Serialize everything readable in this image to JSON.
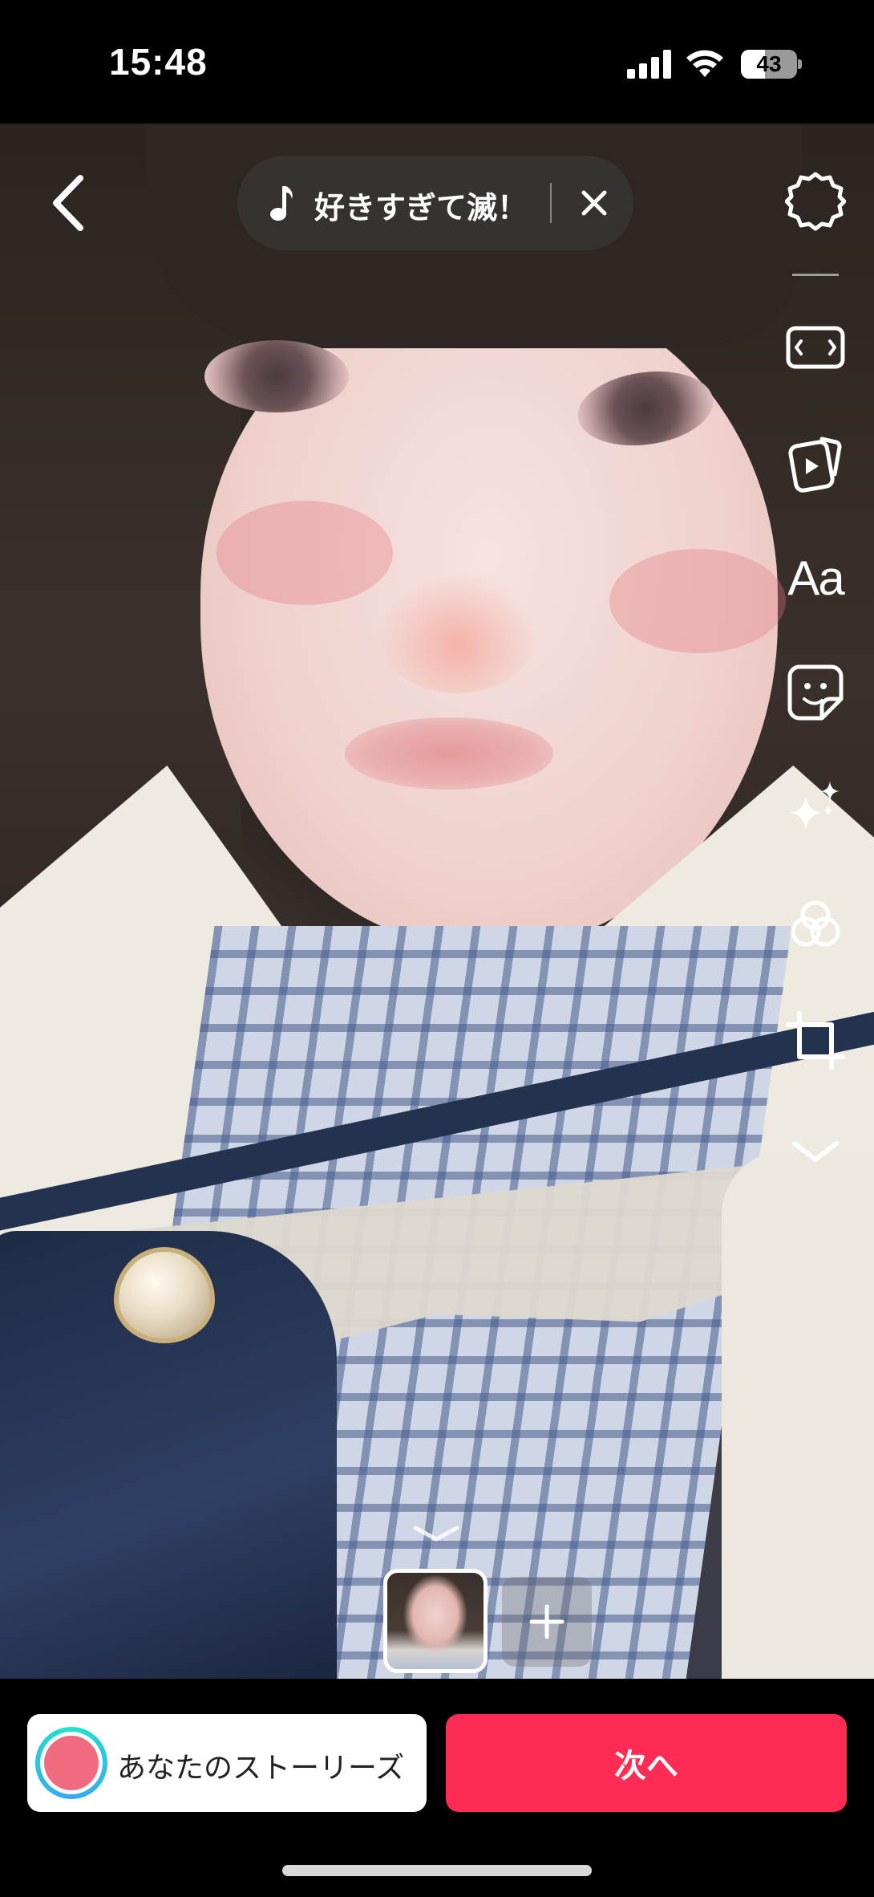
{
  "status_bar": {
    "time": "15:48",
    "battery_level": "43",
    "battery_fraction": 0.43
  },
  "music": {
    "title": "好きすぎて滅！"
  },
  "toolbar": {
    "text_tool_label": "Aa",
    "items": [
      "settings-icon",
      "aspect-ratio-icon",
      "templates-icon",
      "text-icon",
      "sticker-icon",
      "effects-icon",
      "filters-icon",
      "crop-icon",
      "expand-more-icon"
    ]
  },
  "actions": {
    "story_label": "あなたのストーリーズ",
    "next_label": "次へ",
    "story_avatar_color": "#f06b7f",
    "next_color": "#fe2c55"
  }
}
